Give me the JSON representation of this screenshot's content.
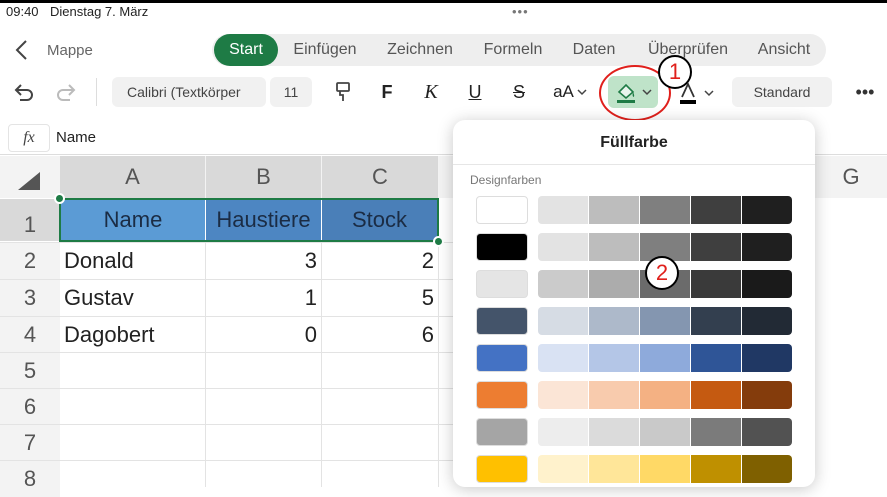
{
  "status_bar": {
    "time": "09:40",
    "date": "Dienstag 7. März",
    "dots": "•••"
  },
  "header": {
    "doc_title": "Mappe"
  },
  "tabs": [
    {
      "label": "Start",
      "active": true
    },
    {
      "label": "Einfügen"
    },
    {
      "label": "Zeichnen"
    },
    {
      "label": "Formeln"
    },
    {
      "label": "Daten"
    },
    {
      "label": "Überprüfen"
    },
    {
      "label": "Ansicht"
    }
  ],
  "toolbar": {
    "font_name": "Calibri (Textkörper",
    "font_size": "11",
    "bold": "F",
    "italic": "K",
    "underline": "U",
    "strike": "S",
    "font_size_tool": "aA",
    "number_format": "Standard",
    "more": "•••",
    "fill_icon": "paint-bucket-icon",
    "fill_color": "#1e7b45"
  },
  "annotations": {
    "one": "1",
    "two": "2",
    "color": "#e0201c"
  },
  "formula_bar": {
    "fx": "fx",
    "value": "Name"
  },
  "columns": [
    "A",
    "B",
    "C",
    "G"
  ],
  "rows": [
    "1",
    "2",
    "3",
    "4",
    "5",
    "6",
    "7",
    "8"
  ],
  "table": {
    "headers": [
      "Name",
      "Haustiere",
      "Stock"
    ],
    "header_fill": "#5b9bd5",
    "rows": [
      [
        "Donald",
        "3",
        "2"
      ],
      [
        "Gustav",
        "1",
        "5"
      ],
      [
        "Dagobert",
        "0",
        "6"
      ]
    ]
  },
  "popover": {
    "title": "Füllfarbe",
    "section": "Designfarben",
    "palette": [
      [
        "#ffffff",
        "#e3e3e3",
        "#bdbdbd",
        "#7f7f7f",
        "#3f3f3f",
        "#1f1f1f"
      ],
      [
        "#000000",
        "#e3e3e3",
        "#bdbdbd",
        "#7f7f7f",
        "#3f3f3f",
        "#1f1f1f"
      ],
      [
        "#e5e5e5",
        "#cbcbcb",
        "#acacac",
        "#6b6b6b",
        "#3a3a3a",
        "#1a1a1a"
      ],
      [
        "#44546a",
        "#d6dce4",
        "#adb9ca",
        "#8496b0",
        "#333f4f",
        "#222a35"
      ],
      [
        "#4472c4",
        "#d9e2f3",
        "#b4c6e7",
        "#8eaadb",
        "#2f5597",
        "#203864"
      ],
      [
        "#ed7d31",
        "#fbe5d6",
        "#f8cbad",
        "#f4b183",
        "#c55a11",
        "#843c0c"
      ],
      [
        "#a5a5a5",
        "#ededed",
        "#dbdbdb",
        "#c9c9c9",
        "#7b7b7b",
        "#525252"
      ],
      [
        "#ffc000",
        "#fff2cc",
        "#ffe699",
        "#ffd966",
        "#bf9000",
        "#7f6000"
      ]
    ]
  }
}
